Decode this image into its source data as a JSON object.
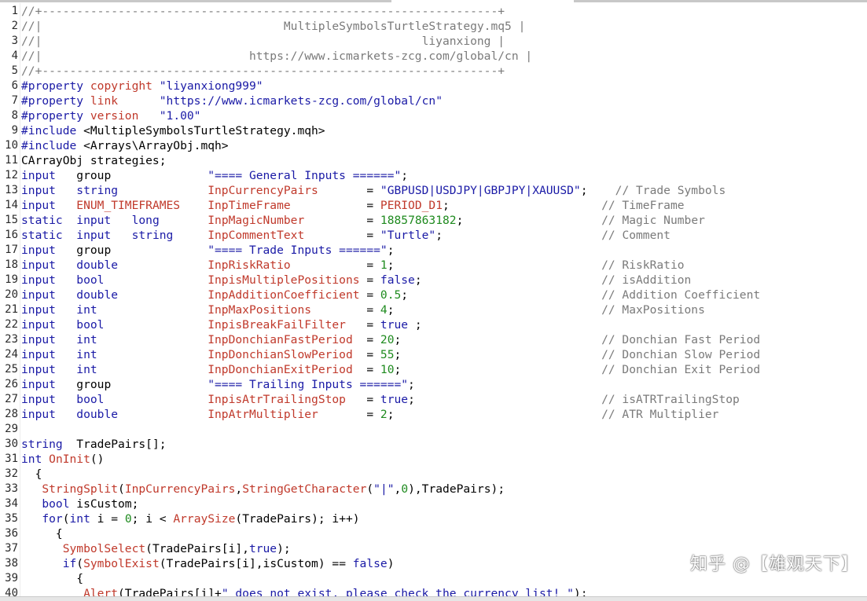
{
  "editor": {
    "lines": [
      {
        "n": "1",
        "segs": [
          [
            "c-cmt",
            "//+------------------------------------------------------------------+"
          ]
        ]
      },
      {
        "n": "2",
        "segs": [
          [
            "c-cmt",
            "//|                                   MultipleSymbolsTurtleStrategy.mq5 |"
          ]
        ]
      },
      {
        "n": "3",
        "segs": [
          [
            "c-cmt",
            "//|                                                       liyanxiong |"
          ]
        ]
      },
      {
        "n": "4",
        "segs": [
          [
            "c-cmt",
            "//|                              https://www.icmarkets-zcg.com/global/cn |"
          ]
        ]
      },
      {
        "n": "5",
        "segs": [
          [
            "c-cmt",
            "//+------------------------------------------------------------------+"
          ]
        ]
      },
      {
        "n": "6",
        "segs": [
          [
            "c-kw",
            "#property "
          ],
          [
            "c-prop",
            "copyright "
          ],
          [
            "c-str",
            "\"liyanxiong999\""
          ]
        ]
      },
      {
        "n": "7",
        "segs": [
          [
            "c-kw",
            "#property "
          ],
          [
            "c-prop",
            "link      "
          ],
          [
            "c-str",
            "\"https://www.icmarkets-zcg.com/global/cn\""
          ]
        ]
      },
      {
        "n": "8",
        "segs": [
          [
            "c-kw",
            "#property "
          ],
          [
            "c-prop",
            "version   "
          ],
          [
            "c-str",
            "\"1.00\""
          ]
        ]
      },
      {
        "n": "9",
        "segs": [
          [
            "c-kw",
            "#include "
          ],
          [
            "c-plain",
            "<MultipleSymbolsTurtleStrategy.mqh>"
          ]
        ]
      },
      {
        "n": "10",
        "segs": [
          [
            "c-kw",
            "#include "
          ],
          [
            "c-plain",
            "<Arrays\\ArrayObj.mqh>"
          ]
        ]
      },
      {
        "n": "11",
        "segs": [
          [
            "c-plain",
            "CArrayObj strategies;"
          ]
        ]
      },
      {
        "n": "12",
        "segs": [
          [
            "c-kw",
            "input   "
          ],
          [
            "c-plain",
            "group              "
          ],
          [
            "c-str",
            "\"==== General Inputs ======\""
          ],
          [
            "c-plain",
            ";"
          ]
        ]
      },
      {
        "n": "13",
        "segs": [
          [
            "c-kw",
            "input   "
          ],
          [
            "c-type",
            "string             "
          ],
          [
            "c-var",
            "InpCurrencyPairs       "
          ],
          [
            "c-plain",
            "= "
          ],
          [
            "c-str",
            "\"GBPUSD|USDJPY|GBPJPY|XAUUSD\""
          ],
          [
            "c-plain",
            ";    "
          ],
          [
            "c-cmt",
            "// Trade Symbols"
          ]
        ]
      },
      {
        "n": "14",
        "segs": [
          [
            "c-kw",
            "input   "
          ],
          [
            "c-enum",
            "ENUM_TIMEFRAMES    "
          ],
          [
            "c-var",
            "InpTimeFrame           "
          ],
          [
            "c-plain",
            "= "
          ],
          [
            "c-var",
            "PERIOD_D1"
          ],
          [
            "c-plain",
            ";                      "
          ],
          [
            "c-cmt",
            "// TimeFrame"
          ]
        ]
      },
      {
        "n": "15",
        "segs": [
          [
            "c-kw",
            "static  input   "
          ],
          [
            "c-type",
            "long       "
          ],
          [
            "c-var",
            "InpMagicNumber         "
          ],
          [
            "c-plain",
            "= "
          ],
          [
            "c-num",
            "18857863182"
          ],
          [
            "c-plain",
            ";                    "
          ],
          [
            "c-cmt",
            "// Magic Number"
          ]
        ]
      },
      {
        "n": "16",
        "segs": [
          [
            "c-kw",
            "static  input   "
          ],
          [
            "c-type",
            "string     "
          ],
          [
            "c-var",
            "InpCommentText         "
          ],
          [
            "c-plain",
            "= "
          ],
          [
            "c-str",
            "\"Turtle\""
          ],
          [
            "c-plain",
            ";                       "
          ],
          [
            "c-cmt",
            "// Comment"
          ]
        ]
      },
      {
        "n": "17",
        "segs": [
          [
            "c-kw",
            "input   "
          ],
          [
            "c-plain",
            "group              "
          ],
          [
            "c-str",
            "\"==== Trade Inputs ======\""
          ],
          [
            "c-plain",
            ";"
          ]
        ]
      },
      {
        "n": "18",
        "segs": [
          [
            "c-kw",
            "input   "
          ],
          [
            "c-type",
            "double             "
          ],
          [
            "c-var",
            "InpRiskRatio           "
          ],
          [
            "c-plain",
            "= "
          ],
          [
            "c-num",
            "1"
          ],
          [
            "c-plain",
            ";                              "
          ],
          [
            "c-cmt",
            "// RiskRatio"
          ]
        ]
      },
      {
        "n": "19",
        "segs": [
          [
            "c-kw",
            "input   "
          ],
          [
            "c-type",
            "bool               "
          ],
          [
            "c-var",
            "InpisMultiplePositions "
          ],
          [
            "c-plain",
            "= "
          ],
          [
            "c-kw",
            "false"
          ],
          [
            "c-plain",
            ";                          "
          ],
          [
            "c-cmt",
            "// isAddition"
          ]
        ]
      },
      {
        "n": "20",
        "segs": [
          [
            "c-kw",
            "input   "
          ],
          [
            "c-type",
            "double             "
          ],
          [
            "c-var",
            "InpAdditionCoefficient "
          ],
          [
            "c-plain",
            "= "
          ],
          [
            "c-num",
            "0.5"
          ],
          [
            "c-plain",
            ";                            "
          ],
          [
            "c-cmt",
            "// Addition Coefficient"
          ]
        ]
      },
      {
        "n": "21",
        "segs": [
          [
            "c-kw",
            "input   "
          ],
          [
            "c-type",
            "int                "
          ],
          [
            "c-var",
            "InpMaxPositions        "
          ],
          [
            "c-plain",
            "= "
          ],
          [
            "c-num",
            "4"
          ],
          [
            "c-plain",
            ";                              "
          ],
          [
            "c-cmt",
            "// MaxPositions"
          ]
        ]
      },
      {
        "n": "22",
        "segs": [
          [
            "c-kw",
            "input   "
          ],
          [
            "c-type",
            "bool               "
          ],
          [
            "c-var",
            "InpisBreakFailFilter   "
          ],
          [
            "c-plain",
            "= "
          ],
          [
            "c-kw",
            "true"
          ],
          [
            "c-plain",
            " ;"
          ]
        ]
      },
      {
        "n": "23",
        "segs": [
          [
            "c-kw",
            "input   "
          ],
          [
            "c-type",
            "int                "
          ],
          [
            "c-var",
            "InpDonchianFastPeriod  "
          ],
          [
            "c-plain",
            "= "
          ],
          [
            "c-num",
            "20"
          ],
          [
            "c-plain",
            ";                             "
          ],
          [
            "c-cmt",
            "// Donchian Fast Period"
          ]
        ]
      },
      {
        "n": "24",
        "segs": [
          [
            "c-kw",
            "input   "
          ],
          [
            "c-type",
            "int                "
          ],
          [
            "c-var",
            "InpDonchianSlowPeriod  "
          ],
          [
            "c-plain",
            "= "
          ],
          [
            "c-num",
            "55"
          ],
          [
            "c-plain",
            ";                             "
          ],
          [
            "c-cmt",
            "// Donchian Slow Period"
          ]
        ]
      },
      {
        "n": "25",
        "segs": [
          [
            "c-kw",
            "input   "
          ],
          [
            "c-type",
            "int                "
          ],
          [
            "c-var",
            "InpDonchianExitPeriod  "
          ],
          [
            "c-plain",
            "= "
          ],
          [
            "c-num",
            "10"
          ],
          [
            "c-plain",
            ";                             "
          ],
          [
            "c-cmt",
            "// Donchian Exit Period"
          ]
        ]
      },
      {
        "n": "26",
        "segs": [
          [
            "c-kw",
            "input   "
          ],
          [
            "c-plain",
            "group              "
          ],
          [
            "c-str",
            "\"==== Trailing Inputs ======\""
          ],
          [
            "c-plain",
            ";"
          ]
        ]
      },
      {
        "n": "27",
        "segs": [
          [
            "c-kw",
            "input   "
          ],
          [
            "c-type",
            "bool               "
          ],
          [
            "c-var",
            "InpisAtrTrailingStop   "
          ],
          [
            "c-plain",
            "= "
          ],
          [
            "c-kw",
            "true"
          ],
          [
            "c-plain",
            ";                           "
          ],
          [
            "c-cmt",
            "// isATRTrailingStop"
          ]
        ]
      },
      {
        "n": "28",
        "segs": [
          [
            "c-kw",
            "input   "
          ],
          [
            "c-type",
            "double             "
          ],
          [
            "c-var",
            "InpAtrMultiplier       "
          ],
          [
            "c-plain",
            "= "
          ],
          [
            "c-num",
            "2"
          ],
          [
            "c-plain",
            ";                              "
          ],
          [
            "c-cmt",
            "// ATR Multiplier"
          ]
        ]
      },
      {
        "n": "29",
        "segs": []
      },
      {
        "n": "30",
        "segs": [
          [
            "c-type",
            "string  "
          ],
          [
            "c-plain",
            "TradePairs[];"
          ]
        ]
      },
      {
        "n": "31",
        "segs": [
          [
            "c-type",
            "int "
          ],
          [
            "c-fn",
            "OnInit"
          ],
          [
            "c-plain",
            "()"
          ]
        ]
      },
      {
        "n": "32",
        "segs": [
          [
            "c-plain",
            "  {"
          ]
        ]
      },
      {
        "n": "33",
        "segs": [
          [
            "c-plain",
            "   "
          ],
          [
            "c-fn",
            "StringSplit"
          ],
          [
            "c-plain",
            "("
          ],
          [
            "c-var",
            "InpCurrencyPairs"
          ],
          [
            "c-plain",
            ","
          ],
          [
            "c-fn",
            "StringGetCharacter"
          ],
          [
            "c-plain",
            "("
          ],
          [
            "c-str",
            "\"|\""
          ],
          [
            "c-plain",
            ","
          ],
          [
            "c-num",
            "0"
          ],
          [
            "c-plain",
            "),TradePairs);"
          ]
        ]
      },
      {
        "n": "34",
        "segs": [
          [
            "c-plain",
            "   "
          ],
          [
            "c-type",
            "bool "
          ],
          [
            "c-plain",
            "isCustom;"
          ]
        ]
      },
      {
        "n": "35",
        "segs": [
          [
            "c-plain",
            "   "
          ],
          [
            "c-kw",
            "for"
          ],
          [
            "c-plain",
            "("
          ],
          [
            "c-type",
            "int "
          ],
          [
            "c-plain",
            "i = "
          ],
          [
            "c-num",
            "0"
          ],
          [
            "c-plain",
            "; i < "
          ],
          [
            "c-fn",
            "ArraySize"
          ],
          [
            "c-plain",
            "(TradePairs); i++)"
          ]
        ]
      },
      {
        "n": "36",
        "segs": [
          [
            "c-plain",
            "     {"
          ]
        ]
      },
      {
        "n": "37",
        "segs": [
          [
            "c-plain",
            "      "
          ],
          [
            "c-fn",
            "SymbolSelect"
          ],
          [
            "c-plain",
            "(TradePairs[i],"
          ],
          [
            "c-kw",
            "true"
          ],
          [
            "c-plain",
            ");"
          ]
        ]
      },
      {
        "n": "38",
        "segs": [
          [
            "c-plain",
            "      "
          ],
          [
            "c-kw",
            "if"
          ],
          [
            "c-plain",
            "("
          ],
          [
            "c-fn",
            "SymbolExist"
          ],
          [
            "c-plain",
            "(TradePairs[i],isCustom) == "
          ],
          [
            "c-kw",
            "false"
          ],
          [
            "c-plain",
            ")"
          ]
        ]
      },
      {
        "n": "39",
        "segs": [
          [
            "c-plain",
            "        {"
          ]
        ]
      },
      {
        "n": "40",
        "segs": [
          [
            "c-plain",
            "         "
          ],
          [
            "c-fn",
            "Alert"
          ],
          [
            "c-plain",
            "(TradePairs[i]+"
          ],
          [
            "c-str",
            "\" does not exist, please check the currency list! \""
          ],
          [
            "c-plain",
            ");"
          ]
        ]
      }
    ]
  },
  "watermark": {
    "text": "知乎 @【雄观天下】"
  }
}
